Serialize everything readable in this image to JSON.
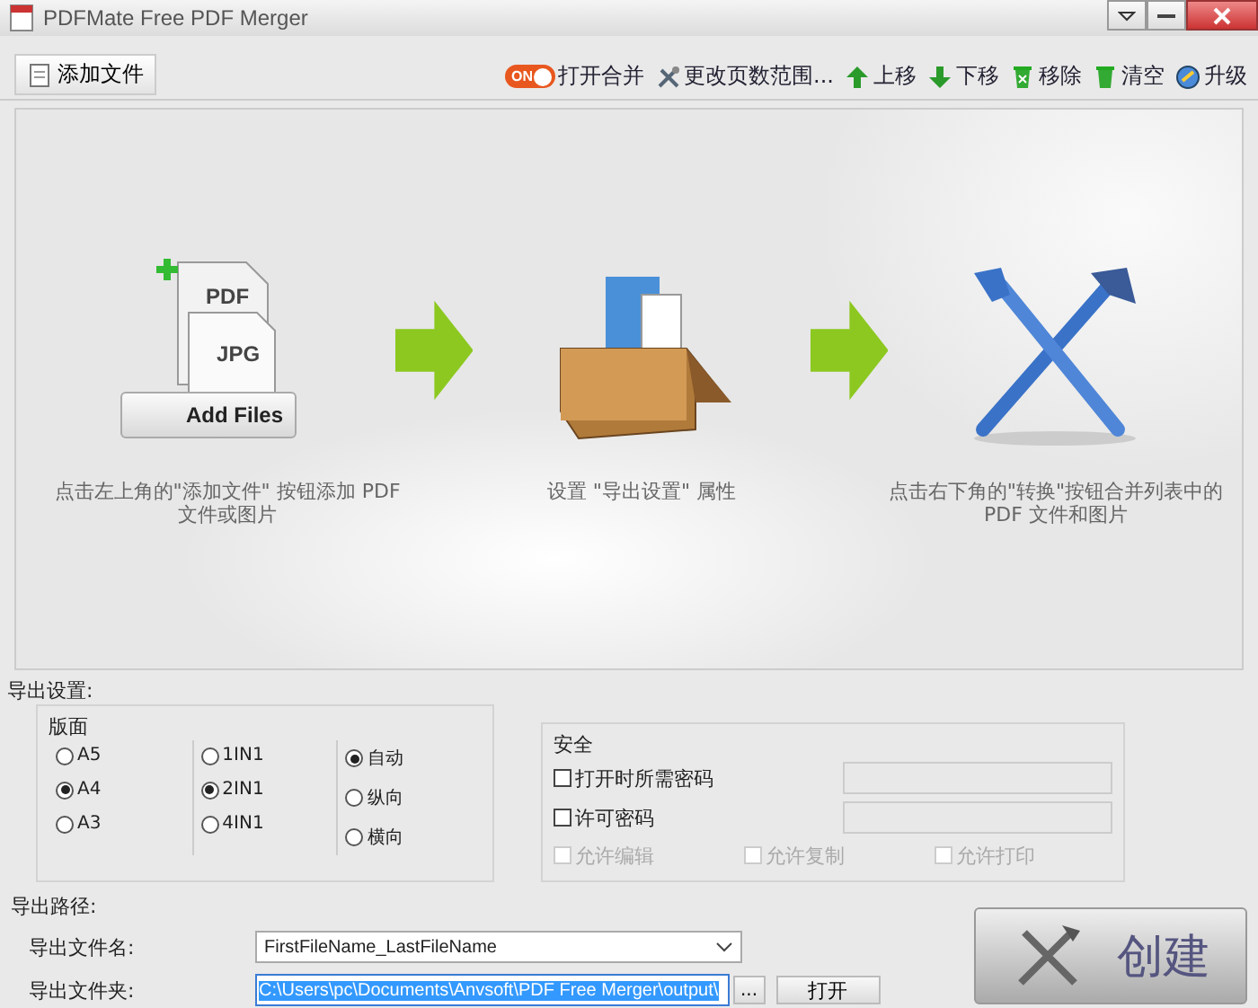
{
  "window": {
    "title": "PDFMate Free PDF Merger"
  },
  "toolbar": {
    "add_button": "添加文件",
    "merge_toggle": {
      "label": "ON",
      "on": true
    },
    "merge_label": "打开合并",
    "actions": [
      {
        "kind": "range",
        "label": "更改页数范围..."
      },
      {
        "kind": "up",
        "label": "上移"
      },
      {
        "kind": "down",
        "label": "下移"
      },
      {
        "kind": "remove",
        "label": "移除"
      },
      {
        "kind": "clear",
        "label": "清空"
      },
      {
        "kind": "upgrade",
        "label": "升级"
      }
    ]
  },
  "steps": [
    {
      "kind": "add-files",
      "doc_labels": [
        "PDF",
        "JPG"
      ],
      "button": "Add Files",
      "caption": "点击左上角的\"添加文件\" 按钮添加 PDF 文件或图片"
    },
    {
      "kind": "settings",
      "caption": "设置 \"导出设置\" 属性"
    },
    {
      "kind": "convert",
      "caption": "点击右下角的\"转换\"按钮合并列表中的 PDF 文件和图片"
    }
  ],
  "export_settings": {
    "title": "导出设置:",
    "layout_title": "版面",
    "layout_columns": [
      [
        {
          "label": "A5",
          "selected": false
        },
        {
          "label": "A4",
          "selected": true
        },
        {
          "label": "A3",
          "selected": false
        }
      ],
      [
        {
          "label": "1IN1",
          "selected": false
        },
        {
          "label": "2IN1",
          "selected": true
        },
        {
          "label": "4IN1",
          "selected": false
        }
      ],
      [
        {
          "label": "自动",
          "selected": true
        },
        {
          "label": "纵向",
          "selected": false
        },
        {
          "label": "横向",
          "selected": false
        }
      ]
    ],
    "security_title": "安全",
    "passwords": [
      {
        "label": "打开时所需密码",
        "checked": false
      },
      {
        "label": "许可密码",
        "checked": false
      }
    ],
    "permissions": [
      {
        "label": "允许编辑",
        "checked": false,
        "disabled": true
      },
      {
        "label": "允许复制",
        "checked": false,
        "disabled": true
      },
      {
        "label": "允许打印",
        "checked": false,
        "disabled": true
      }
    ]
  },
  "export_path": {
    "title": "导出路径:",
    "name_label": "导出文件名:",
    "name_value": "FirstFileName_LastFileName",
    "folder_label": "导出文件夹:",
    "folder_value": "C:\\Users\\pc\\Documents\\Anvsoft\\PDF Free Merger\\output\\",
    "folder_selected": true,
    "browse": "...",
    "open": "打开",
    "create": "创建"
  }
}
